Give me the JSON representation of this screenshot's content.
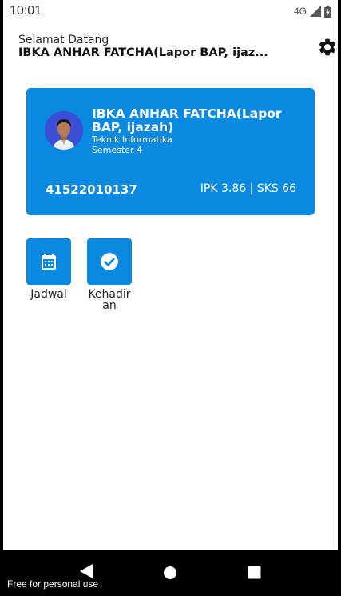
{
  "status_bar": {
    "time": "10:01",
    "network": "4G"
  },
  "header": {
    "welcome": "Selamat Datang",
    "name": "IBKA ANHAR FATCHA(Lapor BAP, ijaz..."
  },
  "card": {
    "name": "IBKA ANHAR FATCHA(Lapor BAP, ijazah)",
    "major": "Teknik Informatika",
    "semester": "Semester 4",
    "nim": "41522010137",
    "stats": "IPK 3.86 | SKS 66"
  },
  "menu": [
    {
      "label": "Jadwal",
      "icon": "calendar-icon"
    },
    {
      "label": "Kehadiran",
      "icon": "check-circle-icon"
    }
  ],
  "watermark": "Free for personal use",
  "colors": {
    "primary": "#0a89e0"
  }
}
